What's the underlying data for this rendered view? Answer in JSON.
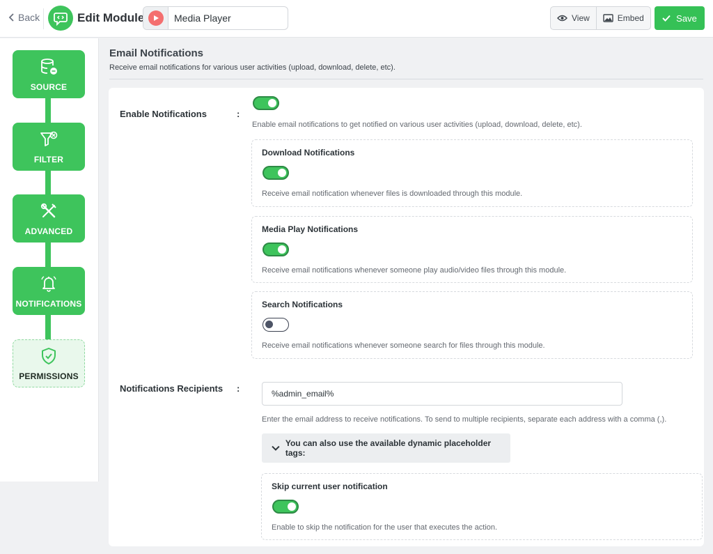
{
  "header": {
    "back_label": "Back",
    "title": "Edit Module",
    "module_name": "Media Player",
    "view_label": "View",
    "embed_label": "Embed",
    "save_label": "Save"
  },
  "sidebar": {
    "steps": [
      {
        "label": "SOURCE",
        "icon": "database-icon"
      },
      {
        "label": "FILTER",
        "icon": "filter-icon"
      },
      {
        "label": "ADVANCED",
        "icon": "tools-icon"
      },
      {
        "label": "NOTIFICATIONS",
        "icon": "bell-icon"
      },
      {
        "label": "PERMISSIONS",
        "icon": "shield-check-icon"
      }
    ]
  },
  "section": {
    "title": "Email Notifications",
    "description": "Receive email notifications for various user activities (upload, download, delete, etc)."
  },
  "enable": {
    "label": "Enable Notifications",
    "colon": ":",
    "on": true,
    "help": "Enable email notifications to get notified on various user activities (upload, download, delete, etc).",
    "subs": [
      {
        "title": "Download Notifications",
        "on": true,
        "help": "Receive email notification whenever files is downloaded through this module."
      },
      {
        "title": "Media Play Notifications",
        "on": true,
        "help": "Receive email notifications whenever someone play audio/video files through this module."
      },
      {
        "title": "Search Notifications",
        "on": false,
        "help": "Receive email notifications whenever someone search for files through this module."
      }
    ]
  },
  "recipients": {
    "label": "Notifications Recipients",
    "colon": ":",
    "value": "%admin_email%",
    "help": "Enter the email address to receive notifications. To send to multiple recipients, separate each address with a comma (,).",
    "placeholder_tags_label": "You can also use the available dynamic placeholder tags:",
    "skip": {
      "title": "Skip current user notification",
      "on": true,
      "help": "Enable to skip the notification for the user that executes the action."
    }
  },
  "colors": {
    "accent": "#3ec45c",
    "save": "#35c156",
    "module_icon": "#f46f6f"
  }
}
